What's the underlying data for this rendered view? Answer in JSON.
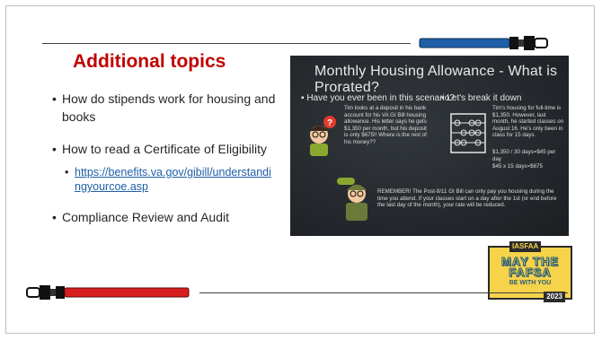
{
  "slide": {
    "title": "Additional topics",
    "bullets": [
      "How do stipends work for housing and books",
      "How to read a Certificate of Eligibility",
      "Compliance Review and Audit"
    ],
    "sub_link": "https://benefits.va.gov/gibill/understandingyourcoe.asp"
  },
  "chalkboard": {
    "title": "Monthly Housing Allowance - What is Prorated?",
    "question": "Have you ever been in this scenario?",
    "breakdown": "Let's break it down",
    "scenario": "Tim looks at a deposit in his bank account for his VA GI Bill housing allowance. His letter says he gets $1,350 per month, but his deposit is only $675!! Where is the rest of his money??",
    "explain_1": "Tim's housing for full-time is $1,350. However, last month, he started classes on August 16. He's only been in class for 15 days.",
    "explain_2": "$1,350 / 30 days=$45 per day",
    "explain_3": "$45 x 15 days=$675",
    "remember": "REMEMBER! The Post-9/11 GI Bill can only pay you housing during the time you attend. If your classes start on a day after the 1st (or end before the last day of the month), your rate will be reduced."
  },
  "badge": {
    "org": "IASFAA",
    "line1": "MAY THE",
    "line2": "FAFSA",
    "line3": "BE WITH YOU",
    "year": "2023"
  },
  "colors": {
    "title": "#c00000",
    "saber_top": "#1f5fa8",
    "saber_bottom": "#d81e1e"
  }
}
